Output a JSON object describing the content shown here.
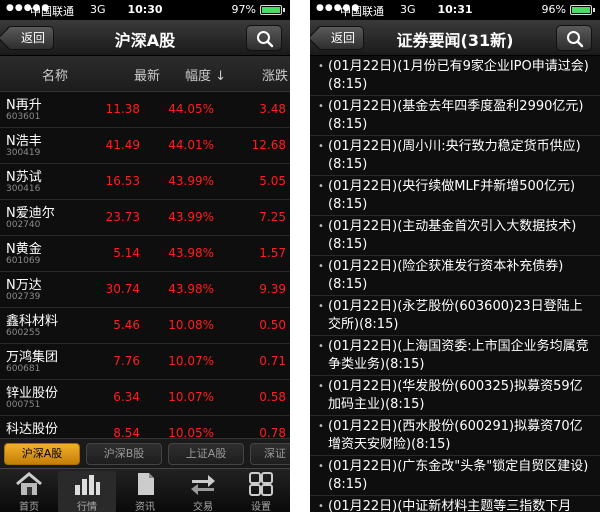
{
  "left": {
    "status": {
      "carrier": "中国联通",
      "network": "3G",
      "time": "10:30",
      "battery": "97%",
      "battery_level": 0.97
    },
    "nav": {
      "back_label": "返回",
      "title": "沪深A股"
    },
    "table": {
      "headers": {
        "name": "名称",
        "price": "最新",
        "pct": "幅度",
        "pct_arrow": "↓",
        "change": "涨跌"
      },
      "rows": [
        {
          "name": "N再升",
          "code": "603601",
          "price": "11.38",
          "pct": "44.05%",
          "change": "3.48"
        },
        {
          "name": "N浩丰",
          "code": "300419",
          "price": "41.49",
          "pct": "44.01%",
          "change": "12.68"
        },
        {
          "name": "N苏试",
          "code": "300416",
          "price": "16.53",
          "pct": "43.99%",
          "change": "5.05"
        },
        {
          "name": "N爱迪尔",
          "code": "002740",
          "price": "23.73",
          "pct": "43.99%",
          "change": "7.25"
        },
        {
          "name": "N黄金",
          "code": "601069",
          "price": "5.14",
          "pct": "43.98%",
          "change": "1.57"
        },
        {
          "name": "N万达",
          "code": "002739",
          "price": "30.74",
          "pct": "43.98%",
          "change": "9.39"
        },
        {
          "name": "鑫科材料",
          "code": "600255",
          "price": "5.46",
          "pct": "10.08%",
          "change": "0.50"
        },
        {
          "name": "万鸿集团",
          "code": "600681",
          "price": "7.76",
          "pct": "10.07%",
          "change": "0.71"
        },
        {
          "name": "锌业股份",
          "code": "000751",
          "price": "6.34",
          "pct": "10.07%",
          "change": "0.58"
        },
        {
          "name": "科达股份",
          "code": "",
          "price": "8.54",
          "pct": "10.05%",
          "change": "0.78"
        }
      ]
    },
    "segments": [
      "沪深A股",
      "沪深B股",
      "上证A股",
      "深证"
    ],
    "tabs": [
      "首页",
      "行情",
      "资讯",
      "交易",
      "设置"
    ]
  },
  "right": {
    "status": {
      "carrier": "中国联通",
      "network": "3G",
      "time": "10:31",
      "battery": "96%",
      "battery_level": 0.96
    },
    "nav": {
      "back_label": "返回",
      "title": "证券要闻(31新)"
    },
    "news": [
      "(01月22日)(1月份已有9家企业IPO申请过会)(8:15)",
      "(01月22日)(基金去年四季度盈利2990亿元)(8:15)",
      "(01月22日)(周小川:央行致力稳定货币供应)(8:15)",
      "(01月22日)(央行续做MLF并新增500亿元)(8:15)",
      "(01月22日)(主动基金首次引入大数据技术)(8:15)",
      "(01月22日)(险企获准发行资本补充债券)(8:15)",
      "(01月22日)(永艺股份(603600)23日登陆上交所)(8:15)",
      "(01月22日)(上海国资委:上市国企业务均属竞争类业务)(8:15)",
      "(01月22日)(华发股份(600325)拟募资59亿加码主业)(8:15)",
      "(01月22日)(西水股份(600291)拟募资70亿增资天安财险)(8:15)",
      "(01月22日)(广东金改\"头条\"锁定自贸区建设)(8:15)",
      "(01月22日)(中证新材料主题等三指数下月"
    ]
  }
}
